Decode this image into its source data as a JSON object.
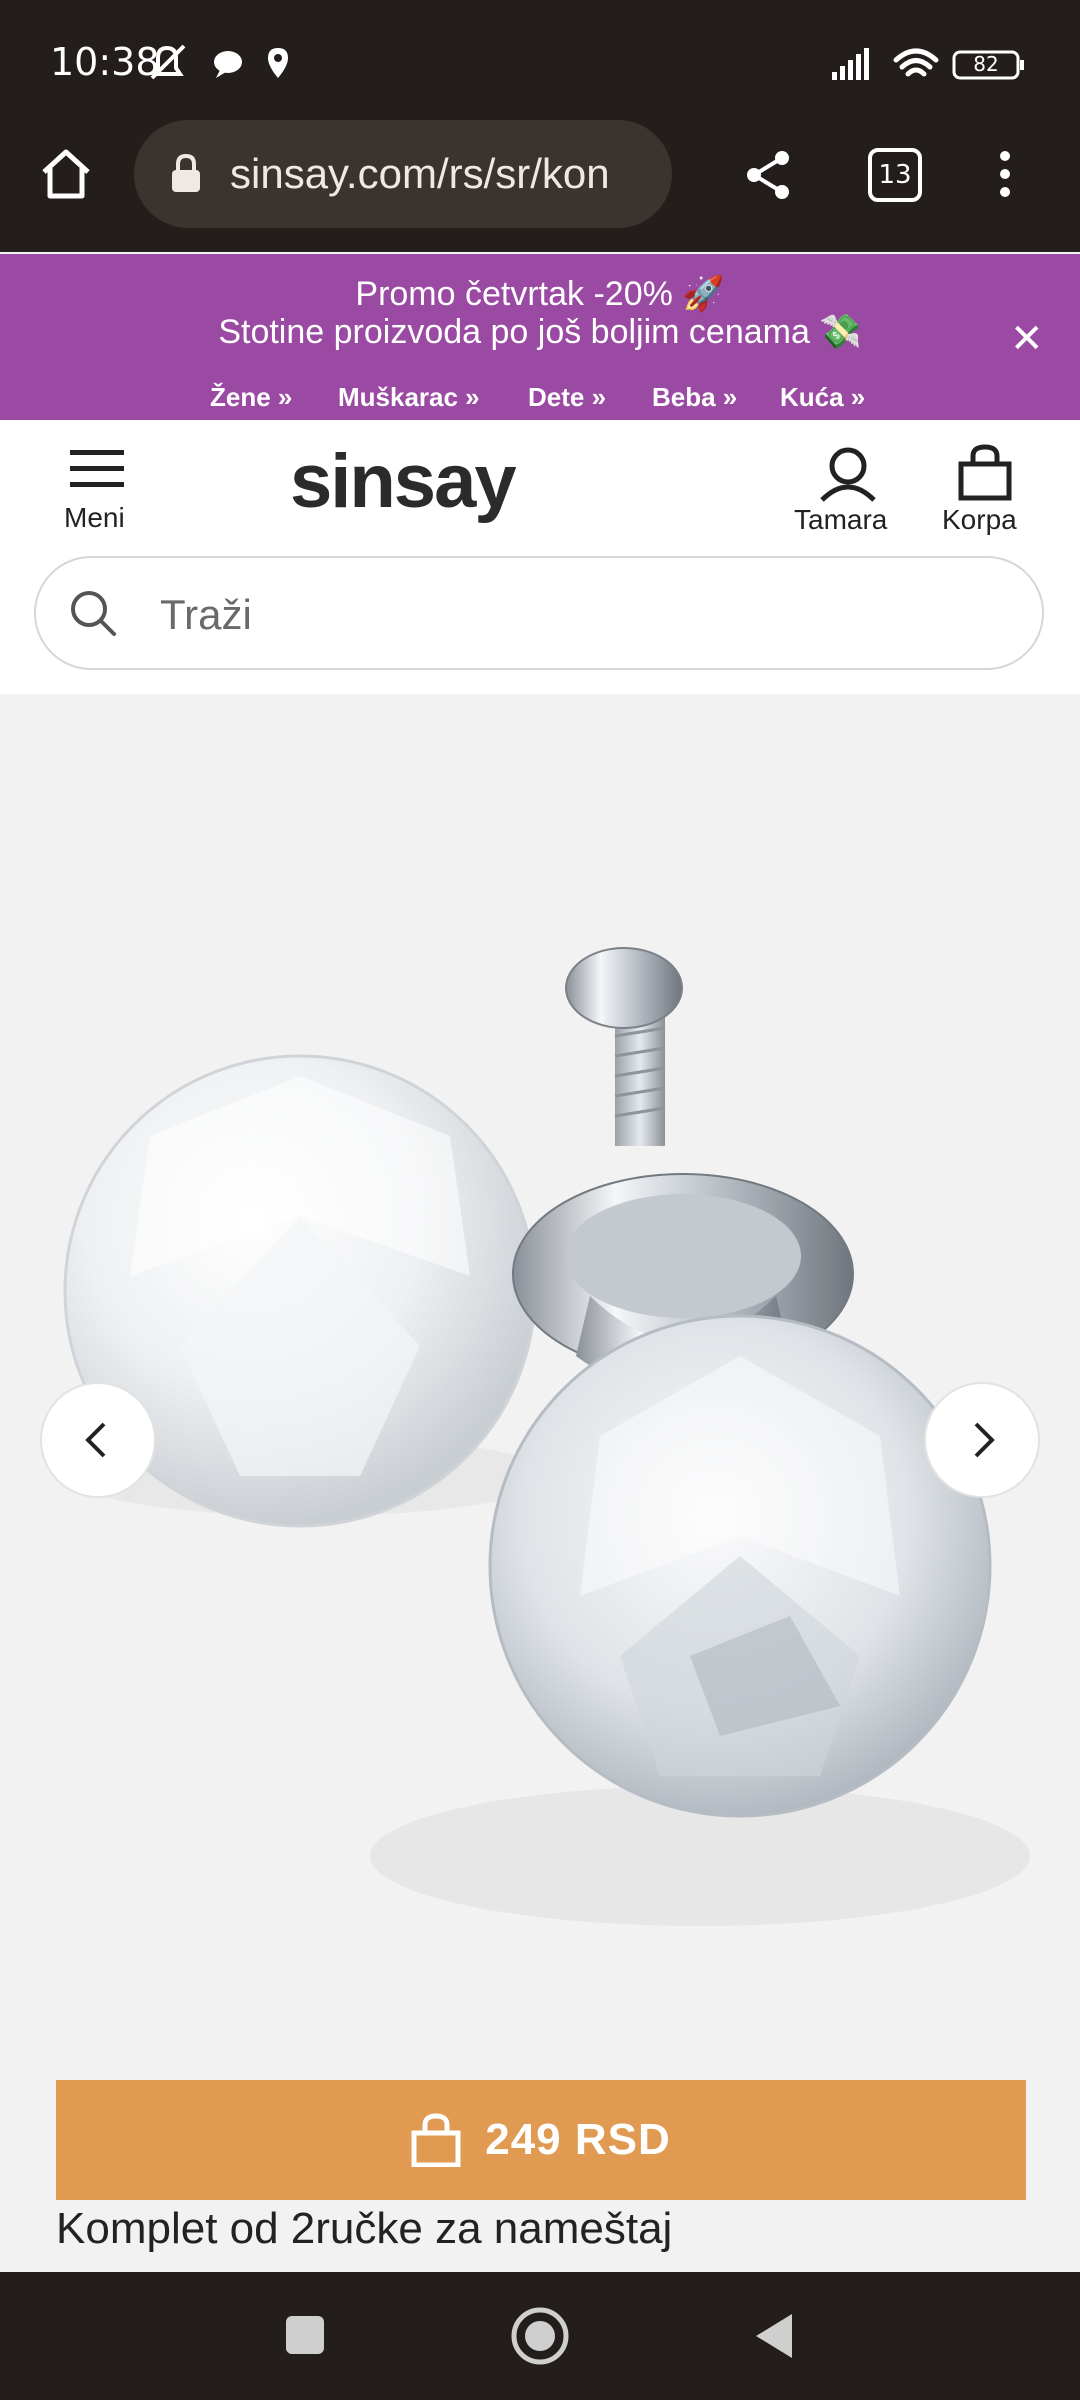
{
  "status_bar": {
    "time": "10:38",
    "battery": "82"
  },
  "browser": {
    "url": "sinsay.com/rs/sr/kon",
    "tab_count": "13"
  },
  "promo": {
    "line1": "Promo četvrtak -20% 🚀",
    "line2": "Stotine proizvoda po još boljim cenama 💸",
    "categories": [
      "Žene »",
      "Muškarac »",
      "Dete »",
      "Beba »",
      "Kuća »"
    ],
    "bg_color": "#9b4aa3"
  },
  "header": {
    "menu_label": "Meni",
    "logo": "sinsay",
    "user_label": "Tamara",
    "cart_label": "Korpa"
  },
  "search": {
    "placeholder": "Traži"
  },
  "product": {
    "price_label": "249 RSD",
    "title": "Komplet od 2ručke za nameštaj",
    "accent_color": "#e09a52"
  }
}
